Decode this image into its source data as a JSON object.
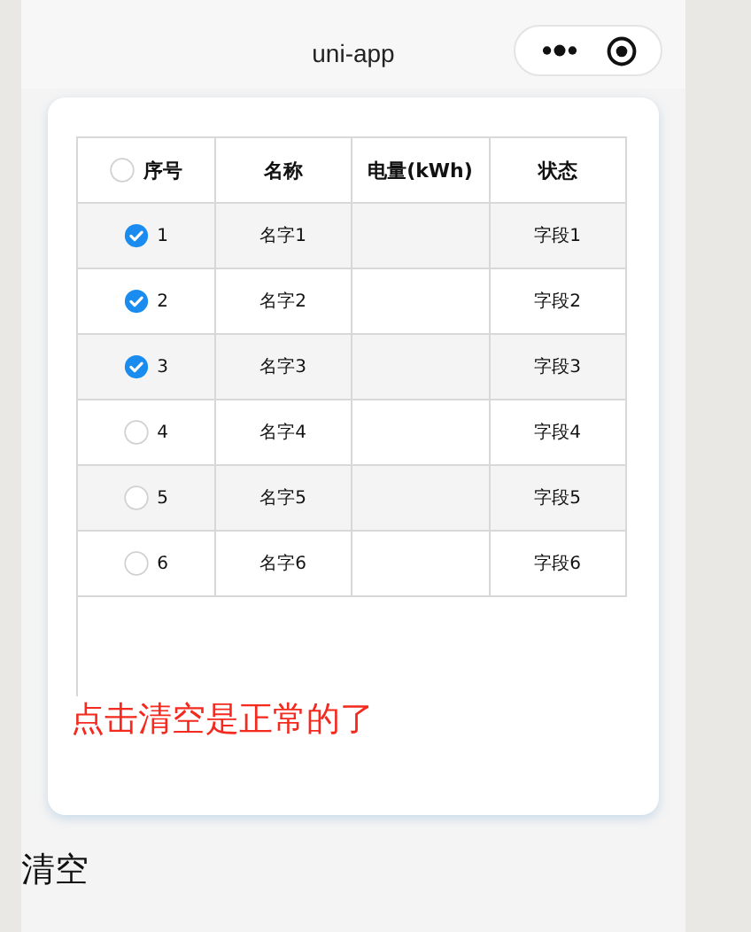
{
  "nav_bar": {
    "title": "uni-app"
  },
  "table": {
    "select_all": {
      "checked": false
    },
    "columns": [
      "序号",
      "名称",
      "电量(kWh)",
      "状态"
    ],
    "rows": [
      {
        "checked": true,
        "cells": [
          "1",
          "名字1",
          "",
          "字段1"
        ]
      },
      {
        "checked": true,
        "cells": [
          "2",
          "名字2",
          "",
          "字段2"
        ]
      },
      {
        "checked": true,
        "cells": [
          "3",
          "名字3",
          "",
          "字段3"
        ]
      },
      {
        "checked": false,
        "cells": [
          "4",
          "名字4",
          "",
          "字段4"
        ]
      },
      {
        "checked": false,
        "cells": [
          "5",
          "名字5",
          "",
          "字段5"
        ]
      },
      {
        "checked": false,
        "cells": [
          "6",
          "名字6",
          "",
          "字段6"
        ]
      }
    ]
  },
  "note": "点击清空是正常的了",
  "clear_label": "清空"
}
